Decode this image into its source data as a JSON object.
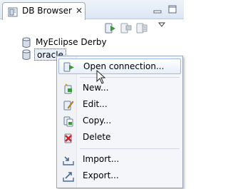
{
  "view": {
    "title": "DB Browser",
    "close_glyph": "✕"
  },
  "toolbar": {
    "buttons": [
      "open-connection-icon",
      "disconnect-icon",
      "database-properties-icon"
    ],
    "view_menu_icon": "chevron-down-icon"
  },
  "tree": {
    "items": [
      {
        "label": "MyEclipse Derby",
        "icon": "database-icon",
        "selected": false
      },
      {
        "label": "oracle",
        "icon": "database-icon",
        "selected": true
      }
    ]
  },
  "context_menu": {
    "items": [
      {
        "label": "Open connection...",
        "icon": "open-connection-icon",
        "hover": true
      },
      {
        "label": "New...",
        "icon": "new-connection-icon"
      },
      {
        "label": "Edit...",
        "icon": "edit-icon"
      },
      {
        "label": "Copy...",
        "icon": "copy-icon"
      },
      {
        "label": "Delete",
        "icon": "delete-icon"
      },
      {
        "label": "Import...",
        "icon": "import-icon"
      },
      {
        "label": "Export...",
        "icon": "export-icon"
      }
    ]
  },
  "colors": {
    "tab_background": "#dce7f3",
    "menu_background": "#f4f6f9",
    "hover_border": "#9fbbe3",
    "accent_green": "#3a9a3a",
    "delete_red": "#d42020"
  }
}
